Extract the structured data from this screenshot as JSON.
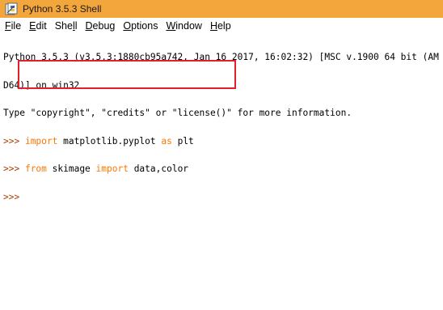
{
  "window": {
    "title": "Python 3.5.3 Shell",
    "icon": "python-idle-icon",
    "titlebar_color": "#f2a63b"
  },
  "menu": {
    "file": {
      "underline": "F",
      "rest": "ile"
    },
    "edit": {
      "underline": "E",
      "rest": "dit"
    },
    "shell": {
      "pre": "She",
      "underline": "l",
      "rest": "l"
    },
    "debug": {
      "underline": "D",
      "rest": "ebug"
    },
    "options": {
      "underline": "O",
      "rest": "ptions"
    },
    "window": {
      "underline": "W",
      "rest": "indow"
    },
    "help": {
      "underline": "H",
      "rest": "elp"
    }
  },
  "shell": {
    "banner_line1": "Python 3.5.3 (v3.5.3:1880cb95a742, Jan 16 2017, 16:02:32) [MSC v.1900 64 bit (AM",
    "banner_line2": "D64)] on win32",
    "banner_line3": "Type \"copyright\", \"credits\" or \"license()\" for more information.",
    "prompt": ">>> ",
    "cmd1_kw1": "import",
    "cmd1_mid": " matplotlib.pyplot ",
    "cmd1_kw2": "as",
    "cmd1_end": " plt",
    "cmd2_kw1": "from",
    "cmd2_mid": " skimage ",
    "cmd2_kw2": "import",
    "cmd2_end": " data,color",
    "prompt_color": "#b03c00",
    "keyword_color": "#ff7700",
    "highlight_color": "#e0202a"
  }
}
